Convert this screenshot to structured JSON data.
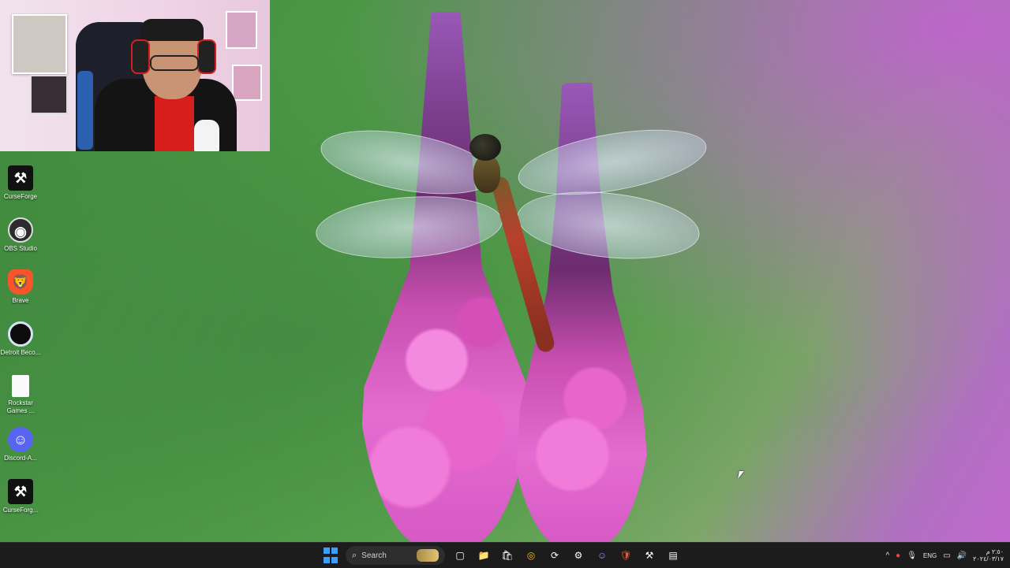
{
  "desktop": {
    "icons": [
      {
        "id": "curseforge",
        "label": "CurseForge",
        "icon": "curseforge-icon",
        "glyph": "⚒"
      },
      {
        "id": "obs",
        "label": "OBS Studio",
        "icon": "obs-icon",
        "glyph": "◉"
      },
      {
        "id": "brave",
        "label": "Brave",
        "icon": "brave-lion-icon",
        "glyph": "🦁"
      },
      {
        "id": "detroit",
        "label": "Detroit Beco...",
        "icon": "detroit-ring-icon",
        "glyph": ""
      },
      {
        "id": "rockstar",
        "label": "Rockstar Games ...",
        "icon": "file-icon",
        "glyph": ""
      },
      {
        "id": "discord",
        "label": "Discord-A...",
        "icon": "discord-icon",
        "glyph": "☺"
      },
      {
        "id": "curseforge2",
        "label": "CurseForg...",
        "icon": "curseforge-icon",
        "glyph": "⚒"
      }
    ]
  },
  "taskbar": {
    "search_label": "Search",
    "apps": [
      {
        "id": "task-view",
        "icon": "task-view-icon",
        "glyph": "▢"
      },
      {
        "id": "file-explorer",
        "icon": "folder-icon",
        "glyph": "📁"
      },
      {
        "id": "store",
        "icon": "store-icon",
        "glyph": "🛍"
      },
      {
        "id": "chrome",
        "icon": "chrome-icon",
        "glyph": "◎"
      },
      {
        "id": "recorder",
        "icon": "recorder-icon",
        "glyph": "⟳"
      },
      {
        "id": "settings",
        "icon": "gear-icon",
        "glyph": "⚙"
      },
      {
        "id": "discord",
        "icon": "discord-icon",
        "glyph": "☺"
      },
      {
        "id": "brave",
        "icon": "brave-lion-icon",
        "glyph": "🛡"
      },
      {
        "id": "curseforge",
        "icon": "curseforge-icon",
        "glyph": "⚒"
      },
      {
        "id": "app-thumb",
        "icon": "app-window-icon",
        "glyph": "▤"
      }
    ],
    "tray": {
      "chevron": "^",
      "language": "ENG",
      "time": "٢:٥٠ م",
      "date": "٢٠٢٤/٠٣/١٧"
    }
  },
  "colors": {
    "accent": "#3aa0ff",
    "taskbar_bg": "#1c1c1c"
  }
}
